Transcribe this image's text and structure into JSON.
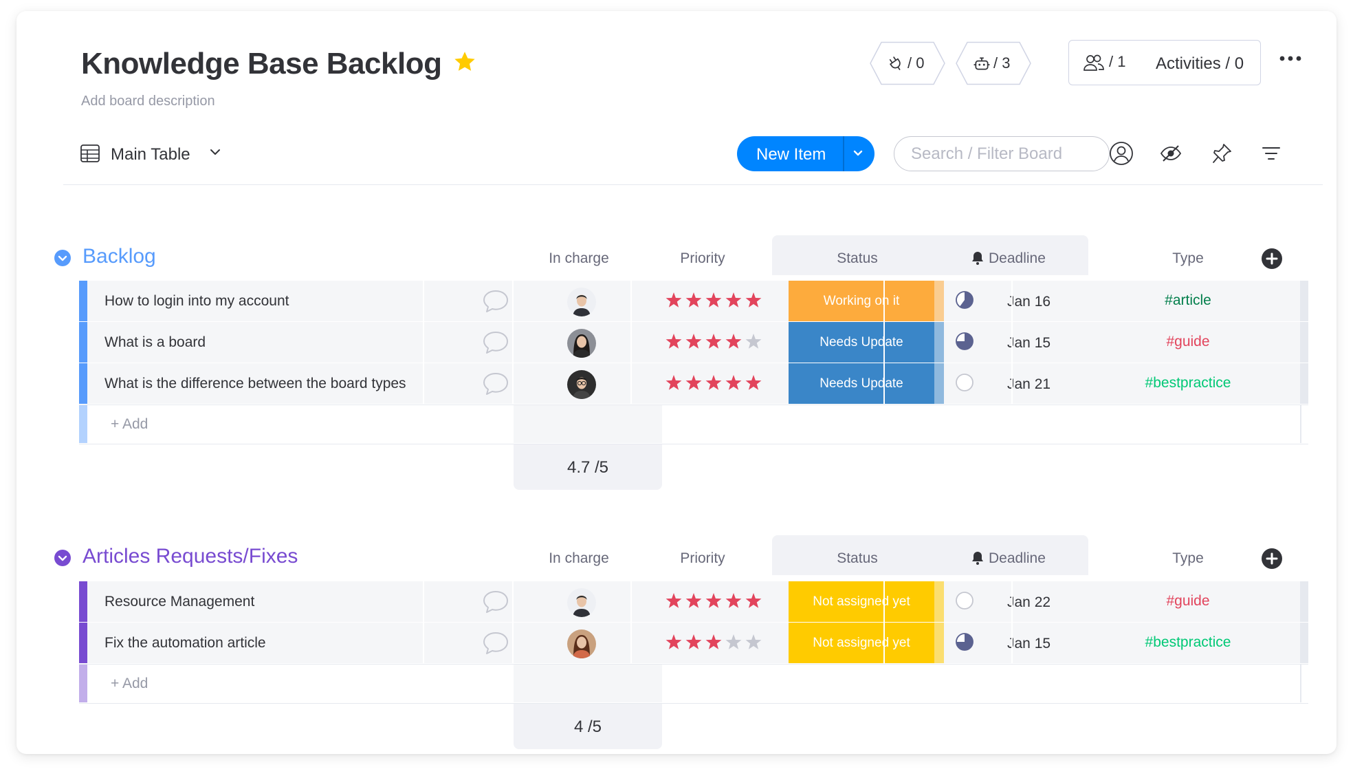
{
  "board": {
    "title": "Knowledge Base Backlog",
    "description": "Add board description"
  },
  "header": {
    "integrations_count": "/ 0",
    "automations_count": "/ 3",
    "members_count": "/ 1",
    "activities_label": "Activities / 0"
  },
  "toolbar": {
    "view_label": "Main Table",
    "new_item_label": "New Item",
    "search_placeholder": "Search / Filter Board"
  },
  "columns": {
    "in_charge": "In charge",
    "priority": "Priority",
    "status": "Status",
    "deadline": "Deadline",
    "type": "Type"
  },
  "colors": {
    "accent": "#0085ff",
    "group_backlog": "#579bfc",
    "group_articles": "#784bd1",
    "working_on_it": "#fdab3d",
    "needs_update": "#3a86c8",
    "not_assigned": "#ffcb00",
    "star": "#e2445c"
  },
  "groups": [
    {
      "title": "Backlog",
      "color": "#579bfc",
      "add_label": "+ Add",
      "priority_summary": "4.7 /5",
      "items": [
        {
          "name": "How to login into my account",
          "avatar": "male-avatar",
          "stars": 5,
          "status": "Working on it",
          "status_color": "#fdab3d",
          "progress": 0.6,
          "deadline": "Jan 16",
          "type": "#article",
          "type_color": "#037f4c"
        },
        {
          "name": "What is a board",
          "avatar": "female-avatar",
          "stars": 4,
          "status": "Needs Update",
          "status_color": "#3a86c8",
          "progress": 0.75,
          "deadline": "Jan 15",
          "type": "#guide",
          "type_color": "#e2445c"
        },
        {
          "name": "What is the difference between the board types",
          "avatar": "male-avatar-glasses",
          "stars": 5,
          "status": "Needs Update",
          "status_color": "#3a86c8",
          "progress": 0,
          "deadline": "Jan 21",
          "type": "#bestpractice",
          "type_color": "#00c875"
        }
      ]
    },
    {
      "title": "Articles Requests/Fixes",
      "color": "#784bd1",
      "add_label": "+ Add",
      "priority_summary": "4 /5",
      "items": [
        {
          "name": "Resource Management",
          "avatar": "male-avatar",
          "stars": 5,
          "status": "Not assigned yet",
          "status_color": "#ffcb00",
          "progress": 0,
          "deadline": "Jan 22",
          "type": "#guide",
          "type_color": "#e2445c"
        },
        {
          "name": "Fix the automation article",
          "avatar": "female-avatar-curly",
          "stars": 3,
          "status": "Not assigned yet",
          "status_color": "#ffcb00",
          "progress": 0.75,
          "deadline": "Jan 15",
          "type": "#bestpractice",
          "type_color": "#00c875"
        }
      ]
    }
  ]
}
